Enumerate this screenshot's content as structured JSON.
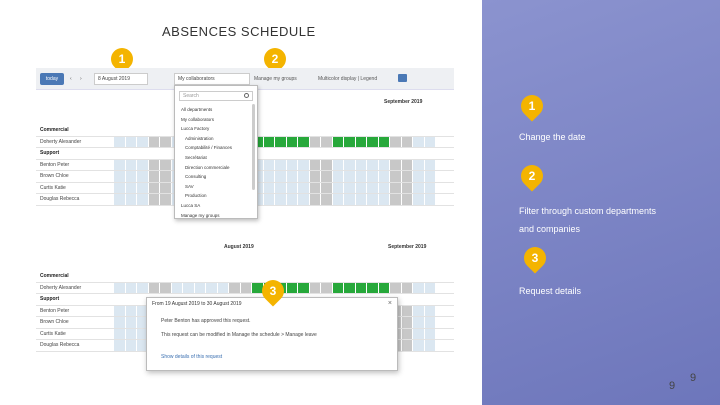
{
  "title": "ABSENCES SCHEDULE",
  "markers": {
    "m1": "1",
    "m2": "2",
    "m3": "3"
  },
  "panel": {
    "step1_label": "Change the date",
    "step2_label_line1": "Filter through custom departments",
    "step2_label_line2": "and companies",
    "step3_label": "Request details"
  },
  "page_numbers": [
    "9",
    "9"
  ],
  "shot1": {
    "today_button": "today",
    "date_value": "8 August 2019",
    "departments_value": "My collaborators",
    "manage_groups": "Manage my groups",
    "multicolor": "Multicolor display | Legend",
    "months": {
      "september": "September 2019"
    },
    "dropdown": {
      "search_placeholder": "Search",
      "items": [
        {
          "label": "All departments",
          "sub": false
        },
        {
          "label": "My collaborators",
          "sub": false
        },
        {
          "label": "Lucca Factory",
          "sub": false
        },
        {
          "label": "Administration",
          "sub": true
        },
        {
          "label": "Comptabilité / Finances",
          "sub": true
        },
        {
          "label": "Secrétariat",
          "sub": true
        },
        {
          "label": "Direction commerciale",
          "sub": true
        },
        {
          "label": "Consulting",
          "sub": true
        },
        {
          "label": "SAV",
          "sub": true
        },
        {
          "label": "Production",
          "sub": true
        },
        {
          "label": "Lucca SA",
          "sub": false
        },
        {
          "label": "Manage my groups",
          "sub": false
        }
      ]
    },
    "rows": [
      {
        "label": "Commercial",
        "group": true
      },
      {
        "label": "Doherty Alexander",
        "group": false
      },
      {
        "label": "Support",
        "group": true
      },
      {
        "label": "Benton Peter",
        "group": false
      },
      {
        "label": "Brown Chloe",
        "group": false
      },
      {
        "label": "Curtis Katie",
        "group": false
      },
      {
        "label": "Douglas Rebecca",
        "group": false
      }
    ]
  },
  "shot2": {
    "months": {
      "august": "August 2019",
      "september": "September 2019"
    },
    "rows": [
      {
        "label": "Commercial",
        "group": true
      },
      {
        "label": "Doherty Alexander",
        "group": false
      },
      {
        "label": "Support",
        "group": true
      },
      {
        "label": "Benton Peter",
        "group": false
      },
      {
        "label": "Brown Chloe",
        "group": false
      },
      {
        "label": "Curtis Katie",
        "group": false
      },
      {
        "label": "Douglas Rebecca",
        "group": false
      }
    ],
    "popup": {
      "header": "From 19 August 2019 to 30 August 2019",
      "line1": "Peter Benton has approved this request.",
      "line2": "This request can be modified in Manage the schedule > Manage leave",
      "link": "Show details of this request"
    }
  },
  "colors": {
    "accent": "#4a78b5",
    "marker": "#f4b400",
    "approved": "#27a83a",
    "weekend": "#c8c8c8",
    "cell": "#dbe7f1",
    "panel": "#7a82c4"
  }
}
